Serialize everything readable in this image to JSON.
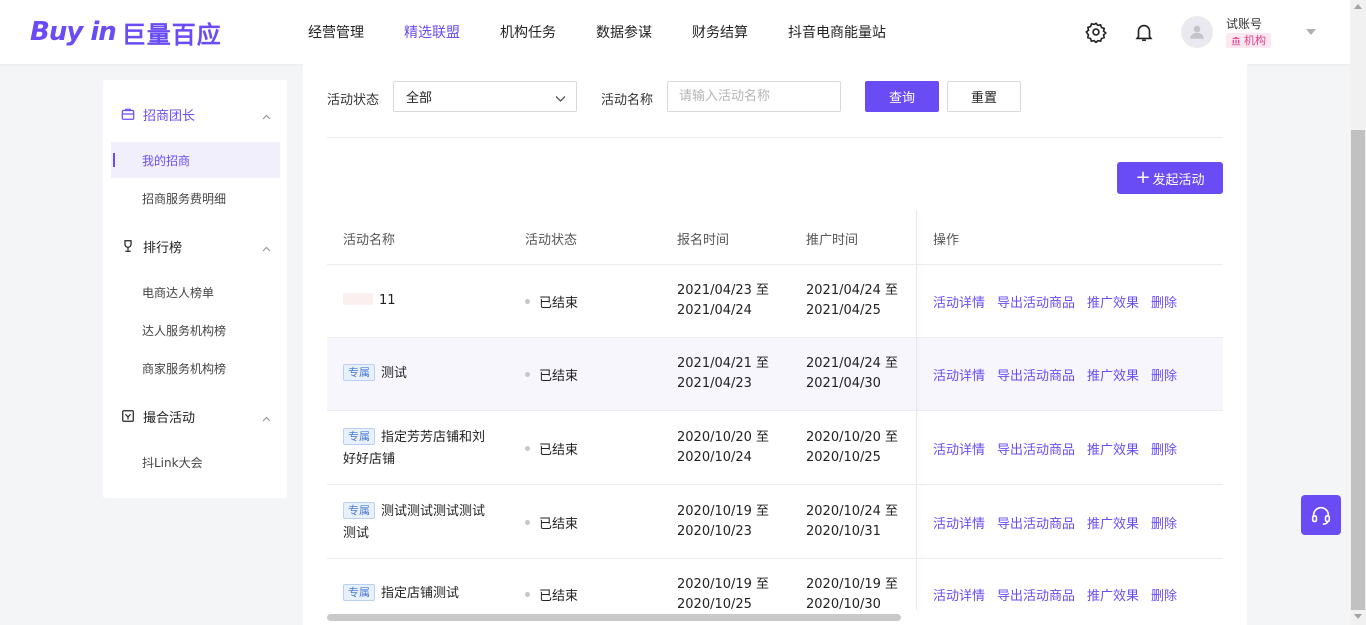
{
  "brand": {
    "logo_en": "Buy in",
    "logo_cn": "巨量百应",
    "accent": "#6a4cf5"
  },
  "nav": {
    "items": [
      {
        "label": "经营管理"
      },
      {
        "label": "精选联盟",
        "active": true
      },
      {
        "label": "机构任务"
      },
      {
        "label": "数据参谋"
      },
      {
        "label": "财务结算"
      },
      {
        "label": "抖音电商能量站"
      }
    ]
  },
  "header_icons": [
    "gear-icon",
    "bell-icon",
    "user-icon",
    "chevron-down-icon"
  ],
  "user": {
    "name": "试账号",
    "role": "机构"
  },
  "sidebar": {
    "groups": [
      {
        "label": "招商团长",
        "icon": "briefcase-icon",
        "active": true,
        "items": [
          {
            "label": "我的招商",
            "active": true
          },
          {
            "label": "招商服务费明细"
          }
        ]
      },
      {
        "label": "排行榜",
        "icon": "trophy-icon",
        "items": [
          {
            "label": "电商达人榜单"
          },
          {
            "label": "达人服务机构榜"
          },
          {
            "label": "商家服务机构榜"
          }
        ]
      },
      {
        "label": "撮合活动",
        "icon": "calendar-icon",
        "items": [
          {
            "label": "抖Link大会"
          }
        ]
      }
    ]
  },
  "filters": {
    "status_label": "活动状态",
    "status_value": "全部",
    "name_label": "活动名称",
    "name_placeholder": "请输入活动名称",
    "name_value": "",
    "query_button": "查询",
    "reset_button": "重置"
  },
  "create_button": "发起活动",
  "table": {
    "columns": [
      "活动名称",
      "活动状态",
      "报名时间",
      "推广时间",
      "操作"
    ],
    "ops": [
      "活动详情",
      "导出活动商品",
      "推广效果",
      "删除"
    ],
    "rows": [
      {
        "tag": "",
        "name": "11",
        "status": "已结束",
        "signup": [
          "2021/04/23 至",
          "2021/04/24"
        ],
        "promo": [
          "2021/04/24 至",
          "2021/04/25"
        ]
      },
      {
        "tag": "专属",
        "name": "测试",
        "status": "已结束",
        "signup": [
          "2021/04/21 至",
          "2021/04/23"
        ],
        "promo": [
          "2021/04/24 至",
          "2021/04/30"
        ]
      },
      {
        "tag": "专属",
        "name": "指定芳芳店铺和刘好好店铺",
        "status": "已结束",
        "signup": [
          "2020/10/20 至",
          "2020/10/24"
        ],
        "promo": [
          "2020/10/20 至",
          "2020/10/25"
        ]
      },
      {
        "tag": "专属",
        "name": "测试测试测试测试测试",
        "status": "已结束",
        "signup": [
          "2020/10/19 至",
          "2020/10/23"
        ],
        "promo": [
          "2020/10/24 至",
          "2020/10/31"
        ]
      },
      {
        "tag": "专属",
        "name": "指定店铺测试",
        "status": "已结束",
        "signup": [
          "2020/10/19 至",
          "2020/10/25"
        ],
        "promo": [
          "2020/10/19 至",
          "2020/10/30"
        ]
      }
    ]
  }
}
